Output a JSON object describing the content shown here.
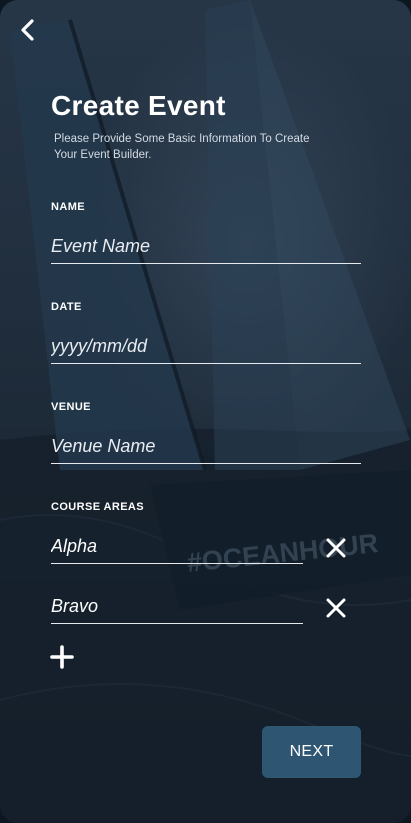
{
  "header": {
    "back_icon": "chevron-left-icon",
    "title": "Create Event",
    "subtitle": "Please Provide Some Basic Information To Create Your Event Builder."
  },
  "form": {
    "name": {
      "label": "NAME",
      "placeholder": "Event Name",
      "value": ""
    },
    "date": {
      "label": "DATE",
      "placeholder": "yyyy/mm/dd",
      "value": ""
    },
    "venue": {
      "label": "VENUE",
      "placeholder": "Venue Name",
      "value": ""
    },
    "course_areas": {
      "label": "COURSE AREAS",
      "items": [
        {
          "value": "Alpha",
          "remove_icon": "close-icon"
        },
        {
          "value": "Bravo",
          "remove_icon": "close-icon"
        }
      ],
      "add_icon": "plus-icon"
    }
  },
  "background": {
    "hull_text": "#OCEANHOUR"
  },
  "actions": {
    "next_label": "NEXT"
  },
  "colors": {
    "button": "#2e5673",
    "text": "#ffffff",
    "background": "#24313f"
  }
}
